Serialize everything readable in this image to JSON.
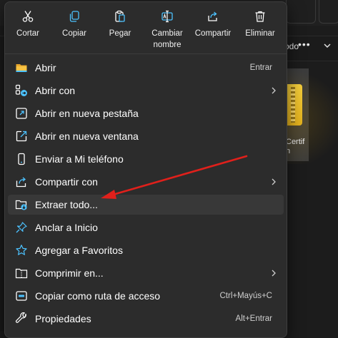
{
  "quick_actions": [
    {
      "label": "Cortar",
      "icon": "cut-icon"
    },
    {
      "label": "Copiar",
      "icon": "copy-icon"
    },
    {
      "label": "Pegar",
      "icon": "paste-icon"
    },
    {
      "label": "Cambiar nombre",
      "icon": "rename-icon"
    },
    {
      "label": "Compartir",
      "icon": "share-icon"
    },
    {
      "label": "Eliminar",
      "icon": "delete-icon"
    }
  ],
  "menu_items": [
    {
      "label": "Abrir",
      "shortcut": "Entrar",
      "icon": "folder-icon"
    },
    {
      "label": "Abrir con",
      "shortcut": "",
      "icon": "open-with-icon",
      "submenu": true
    },
    {
      "label": "Abrir en nueva pestaña",
      "shortcut": "",
      "icon": "new-tab-icon"
    },
    {
      "label": "Abrir en nueva ventana",
      "shortcut": "",
      "icon": "new-window-icon"
    },
    {
      "label": "Enviar a Mi teléfono",
      "shortcut": "",
      "icon": "phone-icon"
    },
    {
      "label": "Compartir con",
      "shortcut": "",
      "icon": "share-with-icon",
      "submenu": true
    },
    {
      "label": "Extraer todo...",
      "shortcut": "",
      "icon": "extract-all-icon",
      "highlighted": true
    },
    {
      "label": "Anclar a Inicio",
      "shortcut": "",
      "icon": "pin-icon"
    },
    {
      "label": "Agregar a Favoritos",
      "shortcut": "",
      "icon": "star-icon"
    },
    {
      "label": "Comprimir en...",
      "shortcut": "",
      "icon": "compress-icon",
      "submenu": true
    },
    {
      "label": "Copiar como ruta de acceso",
      "shortcut": "Ctrl+Mayús+C",
      "icon": "copy-path-icon"
    },
    {
      "label": "Propiedades",
      "shortcut": "Alt+Entrar",
      "icon": "properties-icon"
    }
  ],
  "background": {
    "toolbar_partial_label": "odo",
    "file_label_partial": "Certif",
    "file_label_partial_2": "n"
  },
  "colors": {
    "menu_bg": "#2c2c2c",
    "hover_bg": "#383838",
    "annotation_arrow": "#e0201b",
    "icon_blue": "#4cc2ff",
    "folder_yellow": "#f6c344"
  }
}
